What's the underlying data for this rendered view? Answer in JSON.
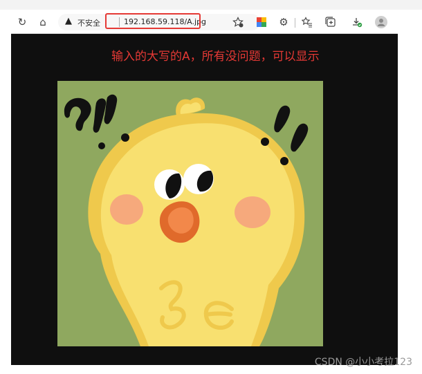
{
  "browser": {
    "address_bar": {
      "security_label": "不安全",
      "url": "192.168.59.118/A.jpg"
    }
  },
  "page": {
    "caption": "输入的大写的A，所有没问题，可以显示",
    "image_alt": "A.jpg"
  },
  "watermark": "CSDN @小小考拉123",
  "icons": {
    "reload": "reload-icon",
    "home": "home-icon",
    "warning": "warning-icon",
    "favorite": "star-add-icon",
    "extension": "extension-icon",
    "settings": "gear-icon",
    "favorites_list": "favorites-icon",
    "collections": "collections-icon",
    "downloads": "download-icon",
    "profile": "avatar-icon"
  },
  "colors": {
    "highlight": "#e53935",
    "viewport_bg": "#0f0f0f",
    "image_bg": "#8fa85f",
    "chick": "#f6dd62"
  }
}
